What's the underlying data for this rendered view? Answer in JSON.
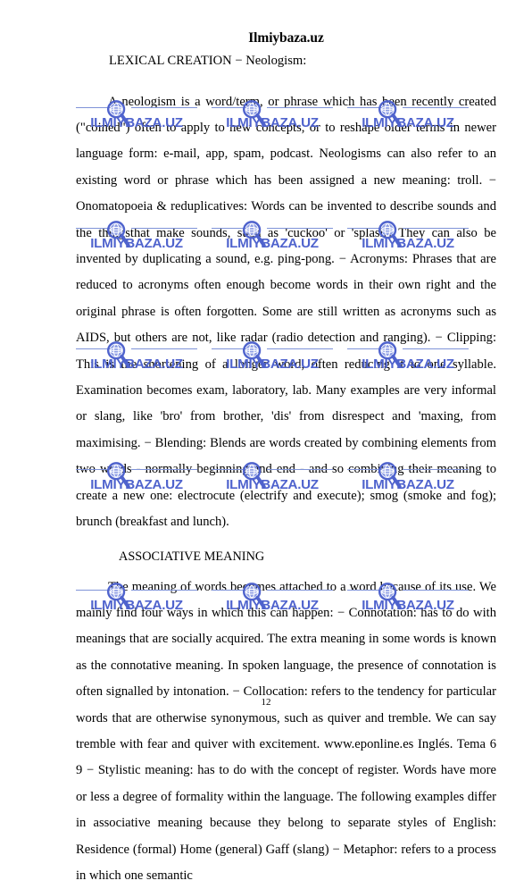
{
  "document": {
    "site_title": "Ilmiybaza.uz",
    "subheading": "LEXICAL CREATION − Neologism:",
    "section_heading": "ASSOCIATIVE MEANING",
    "page_number": "12",
    "paragraphs": [
      "A neologism is a word/term, or phrase which has been recently created (\"coined\") often to apply to new concepts, or to reshape older terms in newer language form: e-mail, app, spam, podcast. Neologisms can also refer to an existing word or phrase which has been assigned a new meaning: troll. − Onomatopoeia & reduplicatives: Words can be invented to describe sounds and the thingsthat make sounds, such as 'cuckoo' or 'splash'. They can also be invented by duplicating a sound, e.g. ping-pong. − Acronyms: Phrases that are reduced to acronyms often enough become words in their own right and the original phrase is often forgotten. Some are still written as acronyms such as AIDS, but others are not, like radar (radio detection and ranging). − Clipping: This is the shortening of a longer word, often reducing it to one syllable. Examination becomes exam, laboratory, lab. Many examples are very informal or slang, like 'bro' from brother, 'dis' from disrespect and 'maxing, from maximising. − Blending: Blends are words created by combining elements from two words - normally beginning and end - and so combining their meaning to create a new one: electrocute (electrify and execute); smog (smoke and fog); brunch (breakfast and lunch).",
      "The meaning of words becomes attached to a word because of its use. We mainly find four ways in which this can happen: − Connotation: has to do with meanings that are socially acquired. The extra meaning in some words is known as the connotative meaning. In spoken language, the presence of connotation is often signalled by intonation. − Collocation: refers to the tendency for particular words that are otherwise synonymous, such as quiver and tremble. We can say tremble with fear and quiver with excitement. www.eponline.es Inglés. Tema 6 9 − Stylistic meaning: has to do with the concept of register. Words have more or less a degree of formality within the language. The following examples differ in associative meaning because they belong to separate styles of English: Residence (formal) Home (general) Gaff (slang) − Metaphor: refers to a process in which one semantic"
    ]
  },
  "watermark": {
    "label": "ILMIYBAZA.UZ",
    "icon": "magnifier-globe-icon",
    "color": "#4f63cd",
    "rule_color": "#7f93d8",
    "columns_x": [
      85,
      237,
      389
    ],
    "rows_y": [
      110,
      245,
      380,
      515,
      650
    ]
  }
}
